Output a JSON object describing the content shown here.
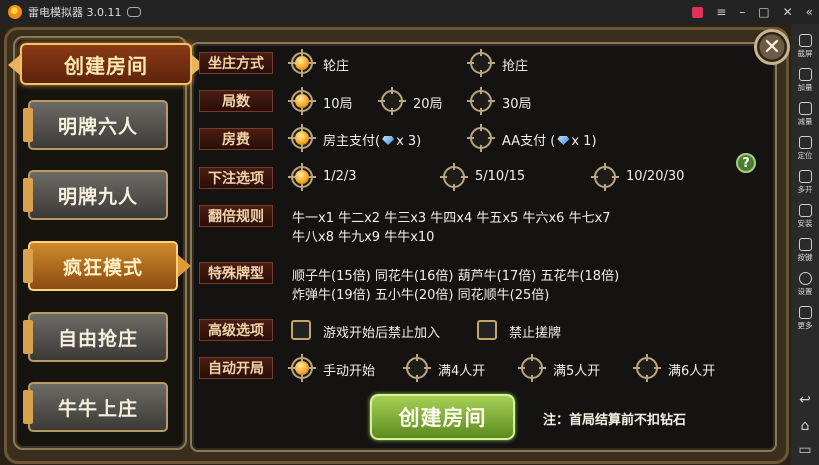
{
  "titlebar": {
    "title": "雷电模拟器 3.0.11"
  },
  "sidebar": {
    "items": [
      "截屏",
      "加量",
      "减量",
      "定位",
      "多开",
      "安装",
      "按键",
      "设置",
      "更多"
    ]
  },
  "left_menu": {
    "title": "创建房间",
    "modes": [
      {
        "label": "明牌六人",
        "active": false
      },
      {
        "label": "明牌九人",
        "active": false
      },
      {
        "label": "疯狂模式",
        "active": true
      },
      {
        "label": "自由抢庄",
        "active": false
      },
      {
        "label": "牛牛上庄",
        "active": false
      }
    ]
  },
  "close_label": "✕",
  "settings": {
    "banker": {
      "label": "坐庄方式",
      "options": [
        {
          "text": "轮庄",
          "selected": true
        },
        {
          "text": "抢庄",
          "selected": false
        }
      ]
    },
    "rounds": {
      "label": "局数",
      "options": [
        {
          "text": "10局",
          "selected": true
        },
        {
          "text": "20局",
          "selected": false
        },
        {
          "text": "30局",
          "selected": false
        }
      ]
    },
    "fee": {
      "label": "房费",
      "options": [
        {
          "text": "房主支付(",
          "count": "x 3)",
          "selected": true
        },
        {
          "text": "AA支付 (",
          "count": "x 1)",
          "selected": false
        }
      ]
    },
    "bet": {
      "label": "下注选项",
      "options": [
        {
          "text": "1/2/3",
          "selected": true
        },
        {
          "text": "5/10/15",
          "selected": false
        },
        {
          "text": "10/20/30",
          "selected": false
        }
      ]
    },
    "double": {
      "label": "翻倍规则",
      "lines": [
        "牛一x1  牛二x2  牛三x3  牛四x4  牛五x5  牛六x6  牛七x7",
        "牛八x8  牛九x9  牛牛x10"
      ]
    },
    "special": {
      "label": "特殊牌型",
      "lines": [
        "顺子牛(15倍)  同花牛(16倍)  葫芦牛(17倍)  五花牛(18倍)",
        "炸弹牛(19倍)  五小牛(20倍)  同花顺牛(25倍)"
      ]
    },
    "advanced": {
      "label": "高级选项",
      "options": [
        {
          "text": "游戏开始后禁止加入",
          "checked": false
        },
        {
          "text": "禁止搓牌",
          "checked": false
        }
      ]
    },
    "autostart": {
      "label": "自动开局",
      "options": [
        {
          "text": "手动开始",
          "selected": true
        },
        {
          "text": "满4人开",
          "selected": false
        },
        {
          "text": "满5人开",
          "selected": false
        },
        {
          "text": "满6人开",
          "selected": false
        }
      ]
    }
  },
  "help_label": "?",
  "create_button": "创建房间",
  "note": "注：首局结算前不扣钻石"
}
